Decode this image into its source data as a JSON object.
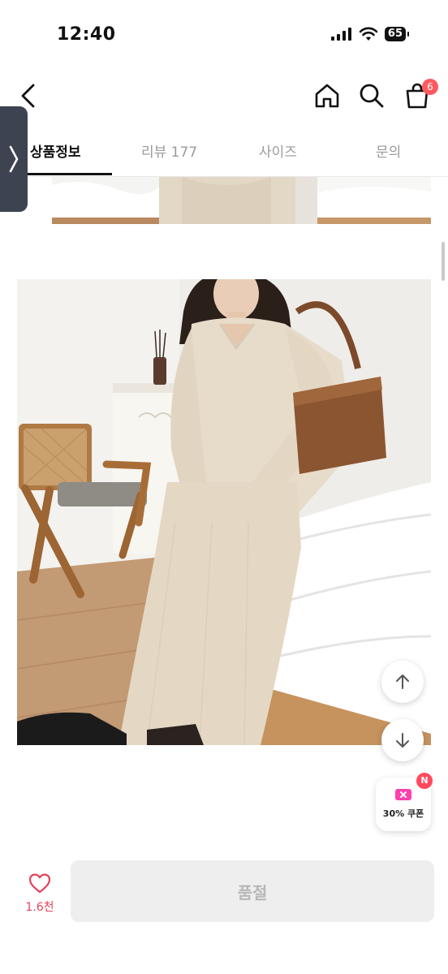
{
  "status_bar": {
    "time": "12:40",
    "battery": "65"
  },
  "header": {
    "cart_count": "6"
  },
  "tabs": [
    {
      "label": "상품정보",
      "active": true
    },
    {
      "label": "리뷰 177",
      "active": false
    },
    {
      "label": "사이즈",
      "active": false
    },
    {
      "label": "문의",
      "active": false
    }
  ],
  "coupon": {
    "label": "30% 쿠폰",
    "badge": "N"
  },
  "bottom": {
    "like_count": "1.6천",
    "buy_label": "품절"
  },
  "colors": {
    "accent": "#ff5a5f",
    "like": "#e2445c",
    "handle": "#3d4350"
  }
}
